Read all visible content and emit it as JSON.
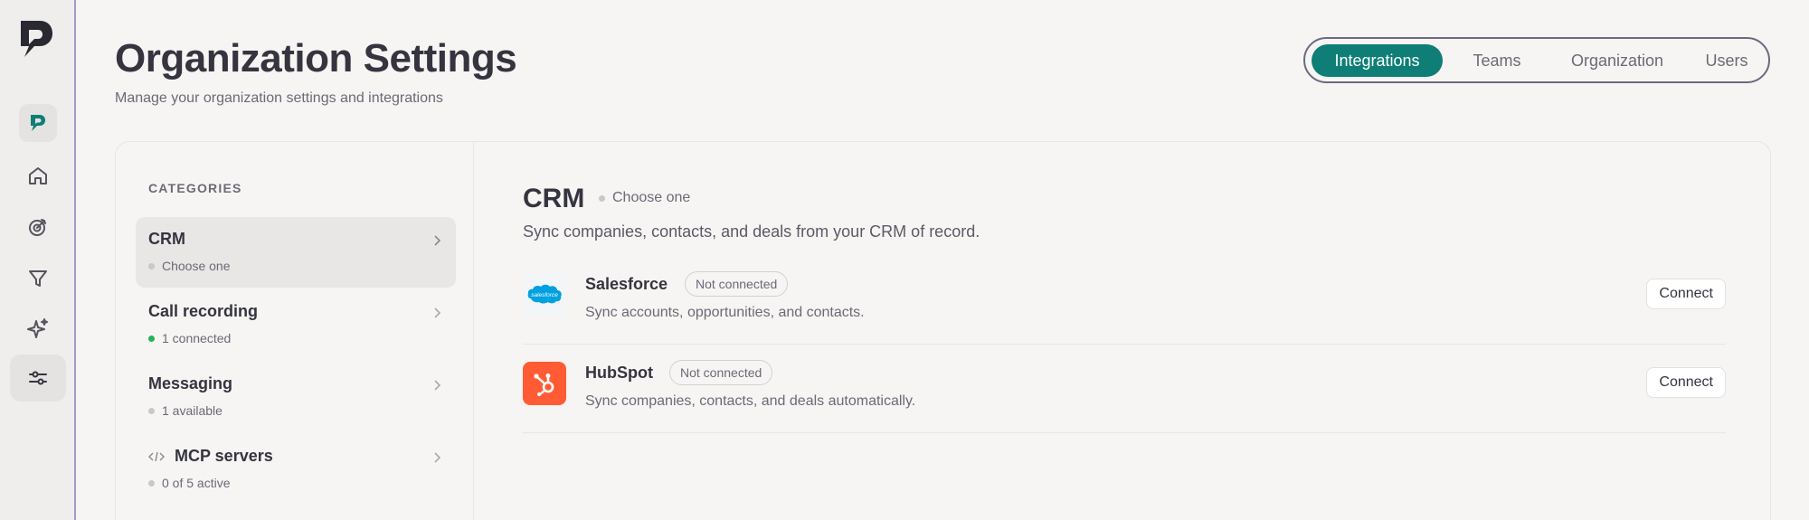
{
  "header": {
    "title": "Organization Settings",
    "subtitle": "Manage your organization settings and integrations"
  },
  "tabs": [
    {
      "label": "Integrations",
      "active": true
    },
    {
      "label": "Teams",
      "active": false
    },
    {
      "label": "Organization",
      "active": false
    },
    {
      "label": "Users",
      "active": false
    }
  ],
  "rail": {
    "icons": [
      "app-logo-icon",
      "brand-icon",
      "home-icon",
      "target-icon",
      "filter-icon",
      "sparkle-icon",
      "sliders-icon"
    ]
  },
  "categories": {
    "heading": "CATEGORIES",
    "items": [
      {
        "label": "CRM",
        "sub": "Choose one",
        "status": "neutral",
        "selected": true
      },
      {
        "label": "Call recording",
        "sub": "1 connected",
        "status": "connected",
        "selected": false
      },
      {
        "label": "Messaging",
        "sub": "1 available",
        "status": "neutral",
        "selected": false
      },
      {
        "label": "MCP servers",
        "sub": "0 of 5 active",
        "status": "neutral",
        "selected": false
      }
    ]
  },
  "crm": {
    "title": "CRM",
    "choose": "Choose one",
    "description": "Sync companies, contacts, and deals from your CRM of record.",
    "integrations": [
      {
        "name": "Salesforce",
        "badge": "Not connected",
        "description": "Sync accounts, opportunities, and contacts.",
        "action": "Connect",
        "logo_text": "salesforce"
      },
      {
        "name": "HubSpot",
        "badge": "Not connected",
        "description": "Sync companies, contacts, and deals automatically.",
        "action": "Connect"
      }
    ]
  },
  "colors": {
    "accent": "#0e7e76",
    "connected": "#22b45a",
    "salesforce": "#00a1e0",
    "hubspot": "#ff5c35"
  }
}
